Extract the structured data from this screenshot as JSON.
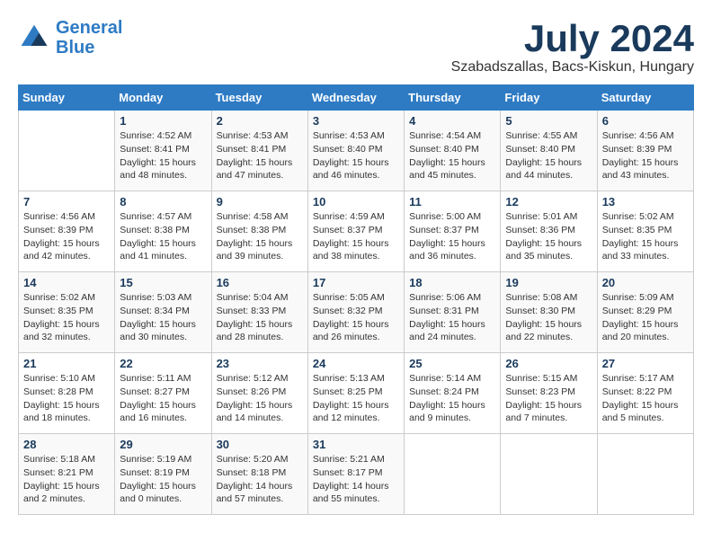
{
  "logo": {
    "line1": "General",
    "line2": "Blue"
  },
  "title": "July 2024",
  "subtitle": "Szabadszallas, Bacs-Kiskun, Hungary",
  "days_header": [
    "Sunday",
    "Monday",
    "Tuesday",
    "Wednesday",
    "Thursday",
    "Friday",
    "Saturday"
  ],
  "weeks": [
    [
      {
        "day": "",
        "info": ""
      },
      {
        "day": "1",
        "info": "Sunrise: 4:52 AM\nSunset: 8:41 PM\nDaylight: 15 hours\nand 48 minutes."
      },
      {
        "day": "2",
        "info": "Sunrise: 4:53 AM\nSunset: 8:41 PM\nDaylight: 15 hours\nand 47 minutes."
      },
      {
        "day": "3",
        "info": "Sunrise: 4:53 AM\nSunset: 8:40 PM\nDaylight: 15 hours\nand 46 minutes."
      },
      {
        "day": "4",
        "info": "Sunrise: 4:54 AM\nSunset: 8:40 PM\nDaylight: 15 hours\nand 45 minutes."
      },
      {
        "day": "5",
        "info": "Sunrise: 4:55 AM\nSunset: 8:40 PM\nDaylight: 15 hours\nand 44 minutes."
      },
      {
        "day": "6",
        "info": "Sunrise: 4:56 AM\nSunset: 8:39 PM\nDaylight: 15 hours\nand 43 minutes."
      }
    ],
    [
      {
        "day": "7",
        "info": "Sunrise: 4:56 AM\nSunset: 8:39 PM\nDaylight: 15 hours\nand 42 minutes."
      },
      {
        "day": "8",
        "info": "Sunrise: 4:57 AM\nSunset: 8:38 PM\nDaylight: 15 hours\nand 41 minutes."
      },
      {
        "day": "9",
        "info": "Sunrise: 4:58 AM\nSunset: 8:38 PM\nDaylight: 15 hours\nand 39 minutes."
      },
      {
        "day": "10",
        "info": "Sunrise: 4:59 AM\nSunset: 8:37 PM\nDaylight: 15 hours\nand 38 minutes."
      },
      {
        "day": "11",
        "info": "Sunrise: 5:00 AM\nSunset: 8:37 PM\nDaylight: 15 hours\nand 36 minutes."
      },
      {
        "day": "12",
        "info": "Sunrise: 5:01 AM\nSunset: 8:36 PM\nDaylight: 15 hours\nand 35 minutes."
      },
      {
        "day": "13",
        "info": "Sunrise: 5:02 AM\nSunset: 8:35 PM\nDaylight: 15 hours\nand 33 minutes."
      }
    ],
    [
      {
        "day": "14",
        "info": "Sunrise: 5:02 AM\nSunset: 8:35 PM\nDaylight: 15 hours\nand 32 minutes."
      },
      {
        "day": "15",
        "info": "Sunrise: 5:03 AM\nSunset: 8:34 PM\nDaylight: 15 hours\nand 30 minutes."
      },
      {
        "day": "16",
        "info": "Sunrise: 5:04 AM\nSunset: 8:33 PM\nDaylight: 15 hours\nand 28 minutes."
      },
      {
        "day": "17",
        "info": "Sunrise: 5:05 AM\nSunset: 8:32 PM\nDaylight: 15 hours\nand 26 minutes."
      },
      {
        "day": "18",
        "info": "Sunrise: 5:06 AM\nSunset: 8:31 PM\nDaylight: 15 hours\nand 24 minutes."
      },
      {
        "day": "19",
        "info": "Sunrise: 5:08 AM\nSunset: 8:30 PM\nDaylight: 15 hours\nand 22 minutes."
      },
      {
        "day": "20",
        "info": "Sunrise: 5:09 AM\nSunset: 8:29 PM\nDaylight: 15 hours\nand 20 minutes."
      }
    ],
    [
      {
        "day": "21",
        "info": "Sunrise: 5:10 AM\nSunset: 8:28 PM\nDaylight: 15 hours\nand 18 minutes."
      },
      {
        "day": "22",
        "info": "Sunrise: 5:11 AM\nSunset: 8:27 PM\nDaylight: 15 hours\nand 16 minutes."
      },
      {
        "day": "23",
        "info": "Sunrise: 5:12 AM\nSunset: 8:26 PM\nDaylight: 15 hours\nand 14 minutes."
      },
      {
        "day": "24",
        "info": "Sunrise: 5:13 AM\nSunset: 8:25 PM\nDaylight: 15 hours\nand 12 minutes."
      },
      {
        "day": "25",
        "info": "Sunrise: 5:14 AM\nSunset: 8:24 PM\nDaylight: 15 hours\nand 9 minutes."
      },
      {
        "day": "26",
        "info": "Sunrise: 5:15 AM\nSunset: 8:23 PM\nDaylight: 15 hours\nand 7 minutes."
      },
      {
        "day": "27",
        "info": "Sunrise: 5:17 AM\nSunset: 8:22 PM\nDaylight: 15 hours\nand 5 minutes."
      }
    ],
    [
      {
        "day": "28",
        "info": "Sunrise: 5:18 AM\nSunset: 8:21 PM\nDaylight: 15 hours\nand 2 minutes."
      },
      {
        "day": "29",
        "info": "Sunrise: 5:19 AM\nSunset: 8:19 PM\nDaylight: 15 hours\nand 0 minutes."
      },
      {
        "day": "30",
        "info": "Sunrise: 5:20 AM\nSunset: 8:18 PM\nDaylight: 14 hours\nand 57 minutes."
      },
      {
        "day": "31",
        "info": "Sunrise: 5:21 AM\nSunset: 8:17 PM\nDaylight: 14 hours\nand 55 minutes."
      },
      {
        "day": "",
        "info": ""
      },
      {
        "day": "",
        "info": ""
      },
      {
        "day": "",
        "info": ""
      }
    ]
  ]
}
